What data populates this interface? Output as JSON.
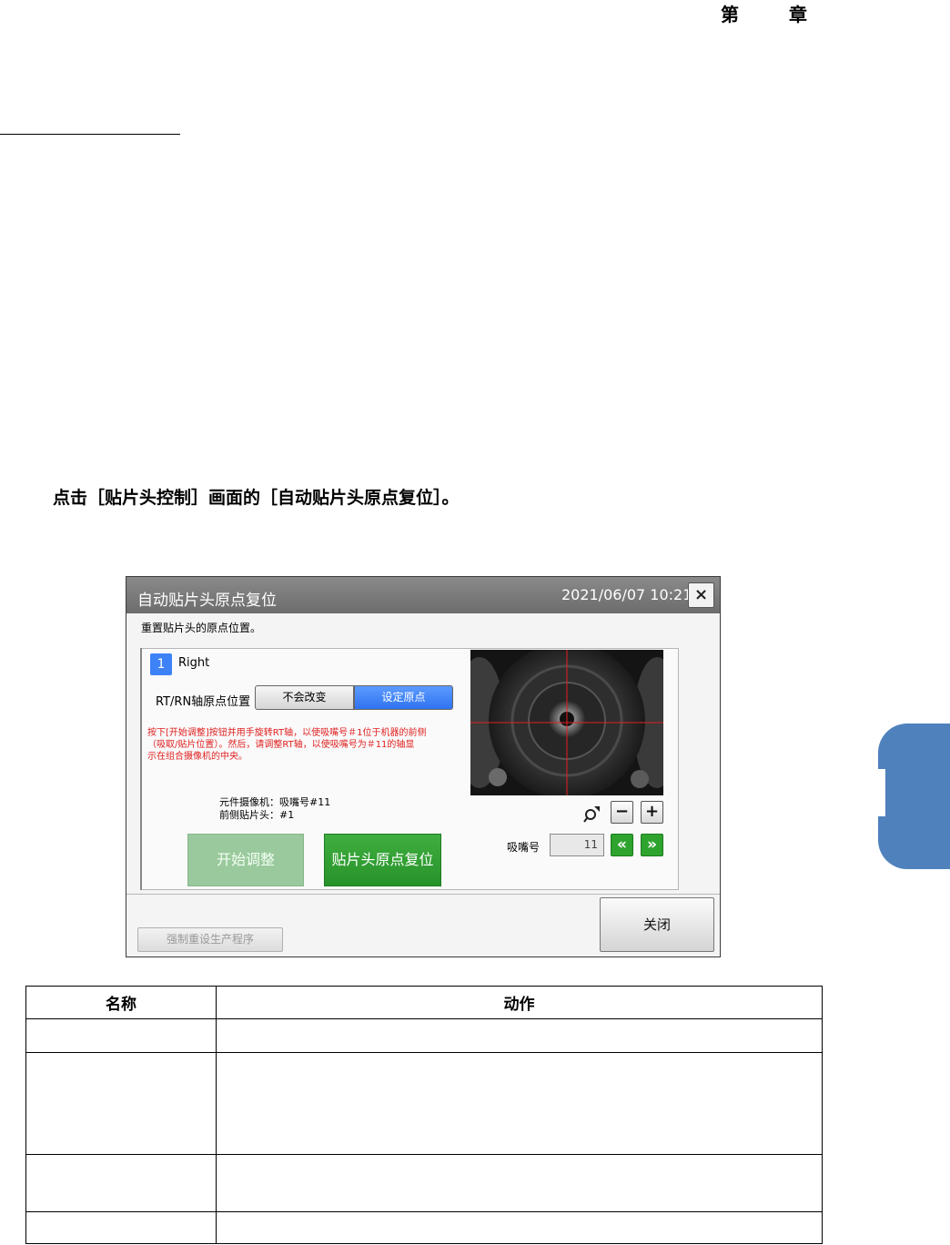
{
  "page": {
    "chapter_label": "第 章",
    "instruction": "点击［贴片头控制］画面的［自动贴片头原点复位］。"
  },
  "dialog": {
    "title": "自动贴片头原点复位",
    "datetime": "2021/06/07 10:21",
    "close_icon": "×",
    "description": "重置贴片头的原点位置。",
    "head": {
      "number": "1",
      "name": "Right"
    },
    "rt_axis": {
      "label": "RT/RN轴原点位置",
      "option_keep": "不会改变",
      "option_set": "设定原点",
      "selected": "设定原点"
    },
    "warning_line1": "按下[开始调整]按钮并用手旋转RT轴，以使吸嘴号＃1位于机器的前侧",
    "warning_line2": "（吸取/贴片位置）。然后，请调整RT轴，以使吸嘴号为＃11的轴显",
    "warning_line3": "示在组合摄像机的中央。",
    "info_camera": "元件摄像机：吸嘴号#11",
    "info_head": "前侧贴片头：#1",
    "start_button": "开始调整",
    "reset_button": "贴片头原点复位",
    "zoom_minus": "−",
    "zoom_plus": "+",
    "nozzle_label": "吸嘴号",
    "nozzle_value": "11",
    "prev_icon": "«",
    "next_icon": "»",
    "close_button": "关闭",
    "force_button": "强制重设生产程序",
    "colors": {
      "titlebar": "#787878",
      "selected_blue": "#3e82f7",
      "action_green": "#2ea32e",
      "warning_red": "#e02020"
    }
  },
  "table": {
    "headers": [
      "名称",
      "动作"
    ],
    "rows": [
      [
        "",
        ""
      ],
      [
        "",
        ""
      ],
      [
        "",
        ""
      ],
      [
        "",
        ""
      ]
    ]
  }
}
